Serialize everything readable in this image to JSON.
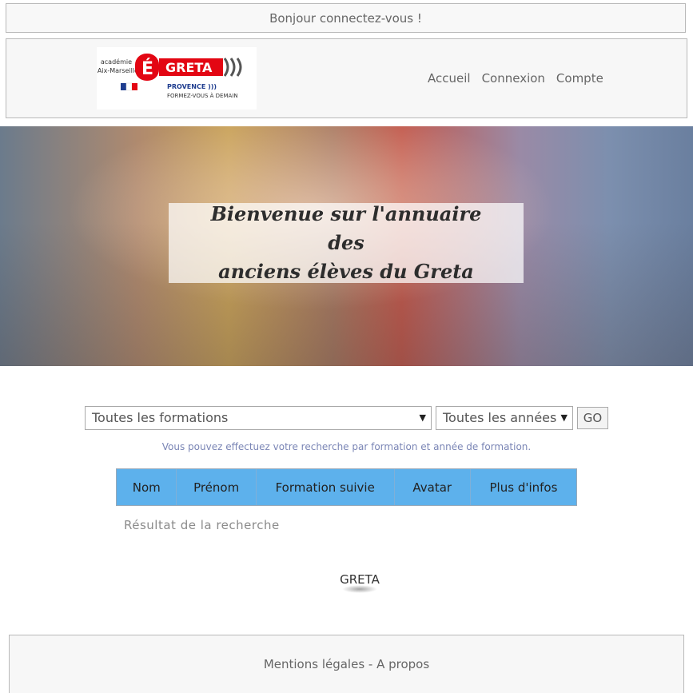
{
  "topbar": {
    "text": "Bonjour connectez-vous !"
  },
  "logo": {
    "academie": "académie",
    "region": "Aix-Marseille",
    "brand": "GRETA",
    "sub1": "PROVENCE )))",
    "sub2": "FORMEZ-VOUS À DEMAIN"
  },
  "nav": {
    "home": "Accueil",
    "login": "Connexion",
    "account": "Compte"
  },
  "hero": {
    "line1": "Bienvenue sur l'annuaire des",
    "line2": "anciens élèves du Greta"
  },
  "search": {
    "formation_value": "Toutes les formations",
    "year_value": "Toutes les années",
    "go_label": "GO",
    "hint": "Vous pouvez effectuez votre recherche par formation et année de formation."
  },
  "table": {
    "columns": [
      "Nom",
      "Prénom",
      "Formation suivie",
      "Avatar",
      "Plus d'infos"
    ]
  },
  "result": {
    "label": "Résultat de la recherche"
  },
  "small_logo": {
    "text": "GRETA"
  },
  "footer": {
    "text": "Mentions légales - A propos"
  },
  "colors": {
    "table_header": "#5db1ec",
    "logo_red": "#e30613",
    "hint": "#7a85b5"
  }
}
